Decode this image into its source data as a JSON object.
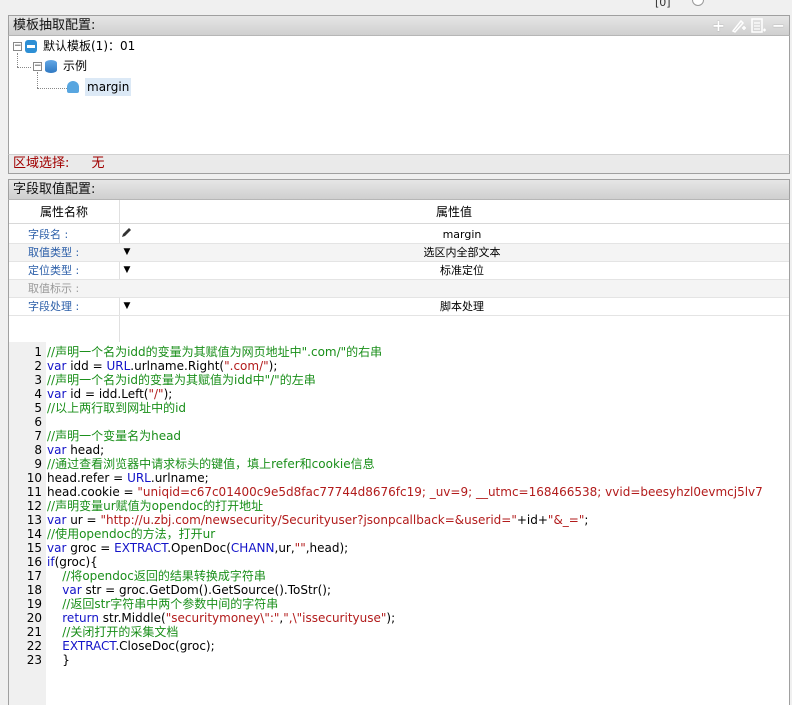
{
  "top_strip": {
    "text": "[0]"
  },
  "template_panel": {
    "title": "模板抽取配置:",
    "tools": [
      "add-icon",
      "edit-add-icon",
      "list-icon",
      "remove-icon"
    ],
    "tree": {
      "root": "默认模板(1)：01",
      "child": "示例",
      "leaf": "margin"
    },
    "region_label": "区域选择:",
    "region_value": "无"
  },
  "field_panel": {
    "title": "字段取值配置:",
    "col_name": "属性名称",
    "col_value": "属性值",
    "rows": [
      {
        "name": "字段名 :",
        "value": "margin",
        "icon": "pencil-icon",
        "disabled": false
      },
      {
        "name": "取值类型 :",
        "value": "选区内全部文本",
        "icon": "dropdown-arrow-icon",
        "disabled": false
      },
      {
        "name": "定位类型 :",
        "value": "标准定位",
        "icon": "dropdown-arrow-icon",
        "disabled": false
      },
      {
        "name": "取值标示 :",
        "value": "",
        "icon": "",
        "disabled": true
      },
      {
        "name": "字段处理 :",
        "value": "脚本处理",
        "icon": "dropdown-arrow-icon",
        "disabled": false
      }
    ]
  },
  "code_lines": [
    {
      "n": "1",
      "t": "//声明一个名为idd的变量为其赋值为网页地址中\".com/\"的右串"
    },
    {
      "n": "2",
      "t": "var idd = URL.urlname.Right(\".com/\");"
    },
    {
      "n": "3",
      "t": "//声明一个名为id的变量为其赋值为idd中\"/\"的左串"
    },
    {
      "n": "4",
      "t": "var id = idd.Left(\"/\");"
    },
    {
      "n": "5",
      "t": "//以上两行取到网址中的id"
    },
    {
      "n": "6",
      "t": ""
    },
    {
      "n": "7",
      "t": "//声明一个变量名为head"
    },
    {
      "n": "8",
      "t": "var head;"
    },
    {
      "n": "9",
      "t": "//通过查看浏览器中请求标头的键值，填上refer和cookie信息"
    },
    {
      "n": "10",
      "t": "head.refer = URL.urlname;"
    },
    {
      "n": "11",
      "t": "head.cookie = \"uniqid=c67c01400c9e5d8fac77744d8676fc19; _uv=9; __utmc=168466538; vvid=beesyhzl0evmcj5lv7"
    },
    {
      "n": "12",
      "t": "//声明变量ur赋值为opendoc的打开地址"
    },
    {
      "n": "13",
      "t": "var ur = \"http://u.zbj.com/newsecurity/Securityuser?jsonpcallback=&userid=\"+id+\"&_=\";"
    },
    {
      "n": "14",
      "t": "//使用opendoc的方法，打开ur"
    },
    {
      "n": "15",
      "t": "var groc = EXTRACT.OpenDoc(CHANN,ur,\"\",head);"
    },
    {
      "n": "16",
      "t": "if(groc){"
    },
    {
      "n": "17",
      "t": "    //将opendoc返回的结果转换成字符串"
    },
    {
      "n": "18",
      "t": "    var str = groc.GetDom().GetSource().ToStr();"
    },
    {
      "n": "19",
      "t": "    //返回str字符串中两个参数中间的字符串"
    },
    {
      "n": "20",
      "t": "    return str.Middle(\"securitymoney\\\":\",\",\\\"issecurityuse\");"
    },
    {
      "n": "21",
      "t": "    //关闭打开的采集文档"
    },
    {
      "n": "22",
      "t": "    EXTRACT.CloseDoc(groc);"
    },
    {
      "n": "23",
      "t": "    }"
    }
  ]
}
